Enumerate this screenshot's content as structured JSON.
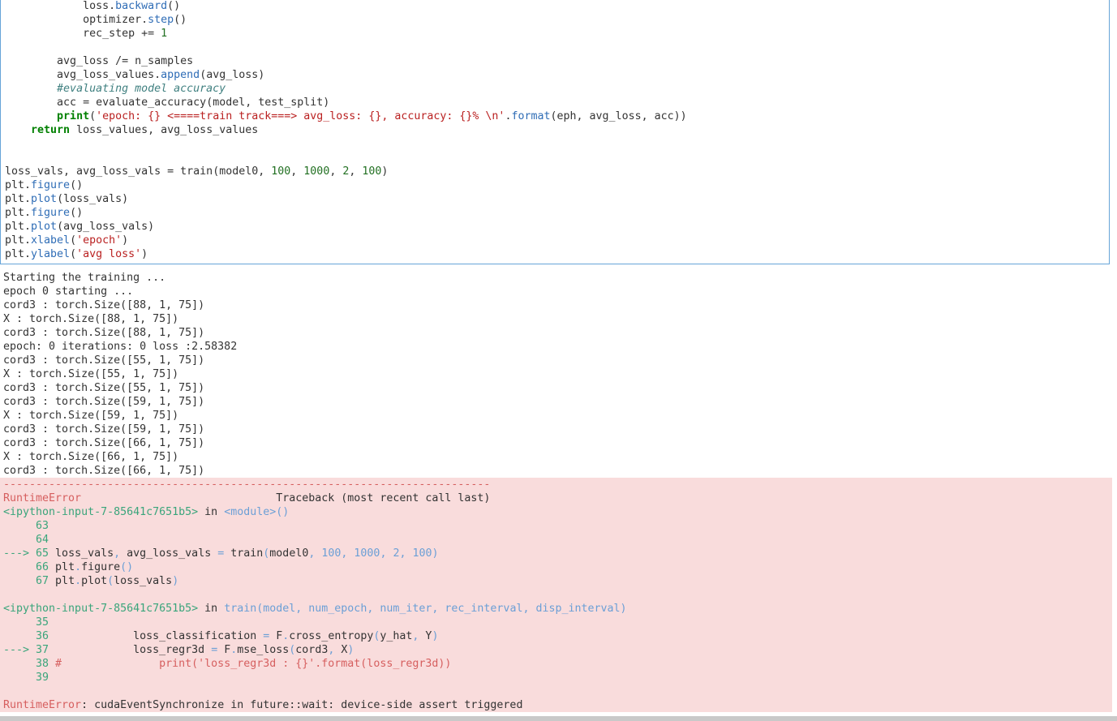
{
  "input_code": {
    "lines": [
      {
        "indent": "            ",
        "parts": [
          [
            "n",
            "loss."
          ],
          [
            "m",
            "backward"
          ],
          [
            "o",
            "()"
          ]
        ]
      },
      {
        "indent": "            ",
        "parts": [
          [
            "n",
            "optimizer."
          ],
          [
            "m",
            "step"
          ],
          [
            "o",
            "()"
          ]
        ]
      },
      {
        "indent": "            ",
        "parts": [
          [
            "n",
            "rec_step "
          ],
          [
            "o",
            "+="
          ],
          [
            "num",
            " 1"
          ]
        ]
      },
      {
        "indent": "",
        "parts": []
      },
      {
        "indent": "        ",
        "parts": [
          [
            "n",
            "avg_loss "
          ],
          [
            "o",
            "/="
          ],
          [
            "n",
            " n_samples"
          ]
        ]
      },
      {
        "indent": "        ",
        "parts": [
          [
            "n",
            "avg_loss_values."
          ],
          [
            "m",
            "append"
          ],
          [
            "o",
            "("
          ],
          [
            "n",
            "avg_loss"
          ],
          [
            "o",
            ")"
          ]
        ]
      },
      {
        "indent": "        ",
        "parts": [
          [
            "c",
            "#evaluating model accuracy"
          ]
        ]
      },
      {
        "indent": "        ",
        "parts": [
          [
            "n",
            "acc "
          ],
          [
            "o",
            "="
          ],
          [
            "n",
            " evaluate_accuracy(model, test_split)"
          ]
        ]
      },
      {
        "indent": "        ",
        "parts": [
          [
            "k",
            "print"
          ],
          [
            "o",
            "("
          ],
          [
            "s",
            "'epoch: {} <====train track===> avg_loss: {}, accuracy: {}% \\n'"
          ],
          [
            "o",
            "."
          ],
          [
            "m",
            "format"
          ],
          [
            "o",
            "("
          ],
          [
            "n",
            "eph, avg_loss, acc))"
          ]
        ]
      },
      {
        "indent": "    ",
        "parts": [
          [
            "k",
            "return"
          ],
          [
            "n",
            " loss_values, avg_loss_values"
          ]
        ]
      },
      {
        "indent": "",
        "parts": []
      },
      {
        "indent": "",
        "parts": []
      },
      {
        "indent": "",
        "parts": [
          [
            "n",
            "loss_vals, avg_loss_vals "
          ],
          [
            "o",
            "="
          ],
          [
            "n",
            " train(model0, "
          ],
          [
            "num",
            "100"
          ],
          [
            "n",
            ", "
          ],
          [
            "num",
            "1000"
          ],
          [
            "n",
            ", "
          ],
          [
            "num",
            "2"
          ],
          [
            "n",
            ", "
          ],
          [
            "num",
            "100"
          ],
          [
            "n",
            ")"
          ]
        ]
      },
      {
        "indent": "",
        "parts": [
          [
            "n",
            "plt."
          ],
          [
            "m",
            "figure"
          ],
          [
            "o",
            "()"
          ]
        ]
      },
      {
        "indent": "",
        "parts": [
          [
            "n",
            "plt."
          ],
          [
            "m",
            "plot"
          ],
          [
            "o",
            "("
          ],
          [
            "n",
            "loss_vals"
          ],
          [
            "o",
            ")"
          ]
        ]
      },
      {
        "indent": "",
        "parts": [
          [
            "n",
            "plt."
          ],
          [
            "m",
            "figure"
          ],
          [
            "o",
            "()"
          ]
        ]
      },
      {
        "indent": "",
        "parts": [
          [
            "n",
            "plt."
          ],
          [
            "m",
            "plot"
          ],
          [
            "o",
            "("
          ],
          [
            "n",
            "avg_loss_vals"
          ],
          [
            "o",
            ")"
          ]
        ]
      },
      {
        "indent": "",
        "parts": [
          [
            "n",
            "plt."
          ],
          [
            "m",
            "xlabel"
          ],
          [
            "o",
            "("
          ],
          [
            "s",
            "'epoch'"
          ],
          [
            "o",
            ")"
          ]
        ]
      },
      {
        "indent": "",
        "parts": [
          [
            "n",
            "plt."
          ],
          [
            "m",
            "ylabel"
          ],
          [
            "o",
            "("
          ],
          [
            "s",
            "'avg loss'"
          ],
          [
            "o",
            ")"
          ]
        ]
      }
    ]
  },
  "stdout": [
    "Starting the training ...",
    "epoch 0 starting ...",
    "cord3 : torch.Size([88, 1, 75])",
    "X : torch.Size([88, 1, 75])",
    "cord3 : torch.Size([88, 1, 75])",
    "epoch: 0 iterations: 0 loss :2.58382",
    "cord3 : torch.Size([55, 1, 75])",
    "X : torch.Size([55, 1, 75])",
    "cord3 : torch.Size([55, 1, 75])",
    "cord3 : torch.Size([59, 1, 75])",
    "X : torch.Size([59, 1, 75])",
    "cord3 : torch.Size([59, 1, 75])",
    "cord3 : torch.Size([66, 1, 75])",
    "X : torch.Size([66, 1, 75])",
    "cord3 : torch.Size([66, 1, 75])"
  ],
  "traceback": {
    "lines": [
      [
        [
          "er",
          "---------------------------------------------------------------------------"
        ]
      ],
      [
        [
          "er",
          "RuntimeError"
        ],
        [
          "tb",
          "                              Traceback (most recent call last)"
        ]
      ],
      [
        [
          "gr",
          "<ipython-input-7-85641c7651b5>"
        ],
        [
          "tb",
          " in "
        ],
        [
          "bl",
          "<module>"
        ],
        [
          "bl",
          "()"
        ]
      ],
      [
        [
          "gr",
          "     63"
        ]
      ],
      [
        [
          "gr",
          "     64"
        ]
      ],
      [
        [
          "gr",
          "---> 65"
        ],
        [
          "tb",
          " loss_vals"
        ],
        [
          "bl",
          ","
        ],
        [
          "tb",
          " avg_loss_vals "
        ],
        [
          "bl",
          "="
        ],
        [
          "tb",
          " train"
        ],
        [
          "bl",
          "("
        ],
        [
          "tb",
          "model0"
        ],
        [
          "bl",
          ","
        ],
        [
          "nu",
          " 100"
        ],
        [
          "bl",
          ","
        ],
        [
          "nu",
          " 1000"
        ],
        [
          "bl",
          ","
        ],
        [
          "nu",
          " 2"
        ],
        [
          "bl",
          ","
        ],
        [
          "nu",
          " 100"
        ],
        [
          "bl",
          ")"
        ]
      ],
      [
        [
          "gr",
          "     66"
        ],
        [
          "tb",
          " plt"
        ],
        [
          "bl",
          "."
        ],
        [
          "tb",
          "figure"
        ],
        [
          "bl",
          "()"
        ]
      ],
      [
        [
          "gr",
          "     67"
        ],
        [
          "tb",
          " plt"
        ],
        [
          "bl",
          "."
        ],
        [
          "tb",
          "plot"
        ],
        [
          "bl",
          "("
        ],
        [
          "tb",
          "loss_vals"
        ],
        [
          "bl",
          ")"
        ]
      ],
      [],
      [
        [
          "gr",
          "<ipython-input-7-85641c7651b5>"
        ],
        [
          "tb",
          " in "
        ],
        [
          "bl",
          "train(model, num_epoch, num_iter, rec_interval, disp_interval)"
        ]
      ],
      [
        [
          "gr",
          "     35"
        ]
      ],
      [
        [
          "gr",
          "     36"
        ],
        [
          "tb",
          "             loss_classification "
        ],
        [
          "bl",
          "="
        ],
        [
          "tb",
          " F"
        ],
        [
          "bl",
          "."
        ],
        [
          "tb",
          "cross_entropy"
        ],
        [
          "bl",
          "("
        ],
        [
          "tb",
          "y_hat"
        ],
        [
          "bl",
          ","
        ],
        [
          "tb",
          " Y"
        ],
        [
          "bl",
          ")"
        ]
      ],
      [
        [
          "gr",
          "---> 37"
        ],
        [
          "tb",
          "             loss_regr3d "
        ],
        [
          "bl",
          "="
        ],
        [
          "tb",
          " F"
        ],
        [
          "bl",
          "."
        ],
        [
          "tb",
          "mse_loss"
        ],
        [
          "bl",
          "("
        ],
        [
          "tb",
          "cord3"
        ],
        [
          "bl",
          ","
        ],
        [
          "tb",
          " X"
        ],
        [
          "bl",
          ")"
        ]
      ],
      [
        [
          "gr",
          "     38"
        ],
        [
          "cm",
          " #               print('loss_regr3d : {}'.format(loss_regr3d))"
        ]
      ],
      [
        [
          "gr",
          "     39"
        ]
      ],
      [],
      [
        [
          "er",
          "RuntimeError"
        ],
        [
          "tb",
          ": cudaEventSynchronize in future::wait: device-side assert triggered"
        ]
      ]
    ]
  },
  "colors": {
    "cell_border": "#66a4d8",
    "error_bg": "#f9dcdc"
  }
}
